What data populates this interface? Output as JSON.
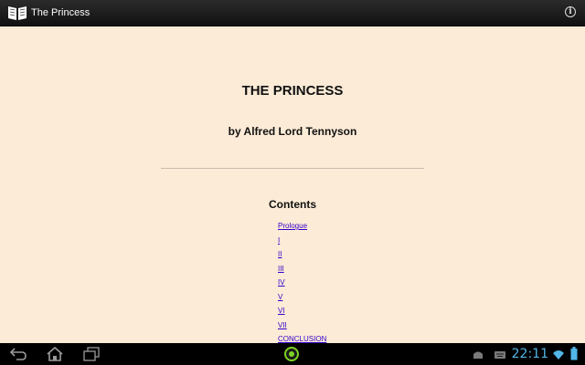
{
  "app": {
    "title": "The Princess",
    "icon": "open-book-icon",
    "info_icon": "info-icon"
  },
  "book": {
    "title": "THE PRINCESS",
    "author": "by Alfred Lord Tennyson",
    "contents_heading": "Contents",
    "toc": [
      "Prologue",
      "I",
      "II",
      "III",
      "IV",
      "V",
      "VI",
      "VII",
      "CONCLUSION"
    ]
  },
  "system_bar": {
    "time": "22:11",
    "icons": [
      "back-icon",
      "home-icon",
      "recent-apps-icon",
      "launcher-icon",
      "usb-debug-icon",
      "keyboard-icon",
      "wifi-icon",
      "battery-icon"
    ]
  },
  "colors": {
    "page_background": "#fcebd6",
    "link": "#3300cc",
    "clock": "#52b6e8",
    "launcher_accent": "#7ed321"
  }
}
